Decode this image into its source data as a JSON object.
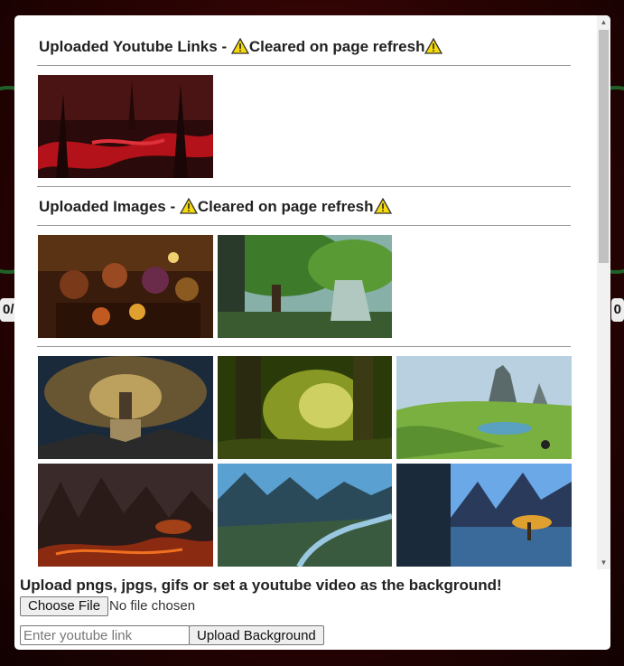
{
  "background": {
    "left_pill": "0/",
    "right_pill": "0"
  },
  "sections": {
    "youtube_title": "Uploaded Youtube Links - ",
    "youtube_warning": "Cleared on page refresh",
    "images_title": "Uploaded Images - ",
    "images_warning": "Cleared on page refresh"
  },
  "youtube_thumbs": [
    {
      "name": "red-swamp"
    }
  ],
  "uploaded_images": [
    {
      "name": "tavern-party"
    },
    {
      "name": "green-forest-cliffs"
    }
  ],
  "gallery_images": [
    {
      "name": "world-tree"
    },
    {
      "name": "mossy-forest"
    },
    {
      "name": "green-valley"
    },
    {
      "name": "volcanic-mountains"
    },
    {
      "name": "blue-canyon-river"
    },
    {
      "name": "sunset-cave-lake"
    }
  ],
  "footer": {
    "title": "Upload pngs, jpgs, gifs or set a youtube video as the background!",
    "choose_file_label": "Choose File",
    "no_file_text": "No file chosen",
    "youtube_placeholder": "Enter youtube link",
    "upload_button_label": "Upload Background"
  },
  "icons": {
    "warning": "warning-icon",
    "scroll_up": "scroll-up-icon",
    "scroll_down": "scroll-down-icon"
  }
}
